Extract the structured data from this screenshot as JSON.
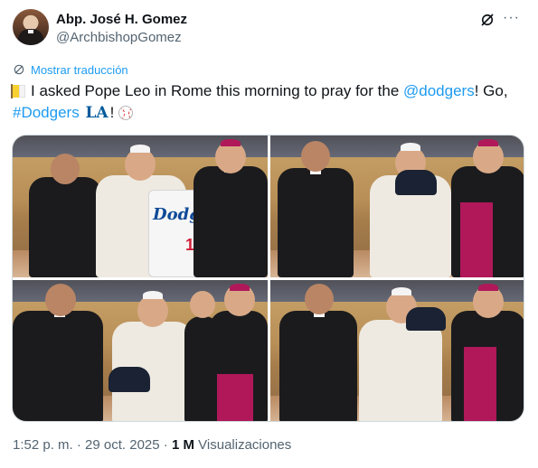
{
  "author": {
    "display_name": "Abp. José H. Gomez",
    "handle": "@ArchbishopGomez",
    "avatar_icon": "profile-photo"
  },
  "actions": {
    "grok_icon": "grok-icon",
    "more_icon": "more-options-icon",
    "more_glyph": "···"
  },
  "translate": {
    "label": "Mostrar traducción",
    "icon": "translate-icon"
  },
  "tweet": {
    "text_part1": "I asked Pope Leo in Rome this morning to pray for the ",
    "mention": "@dodgers",
    "text_part2": "! Go,",
    "hashtag": "#Dodgers",
    "text_part3": "!",
    "la_logo": "LA",
    "emoji_icons": [
      "vatican-flag-icon",
      "dodgers-la-logo-icon",
      "baseball-icon"
    ]
  },
  "media": {
    "jersey_word": "Dodgers",
    "jersey_number": "17"
  },
  "footer": {
    "time": "1:52 p. m.",
    "separator": "·",
    "date": "29 oct. 2025",
    "views_count": "1 M",
    "views_label": "Visualizaciones"
  },
  "colors": {
    "link": "#1d9bf0",
    "text": "#0f1419",
    "secondary": "#536471",
    "border": "#cfd9de"
  }
}
